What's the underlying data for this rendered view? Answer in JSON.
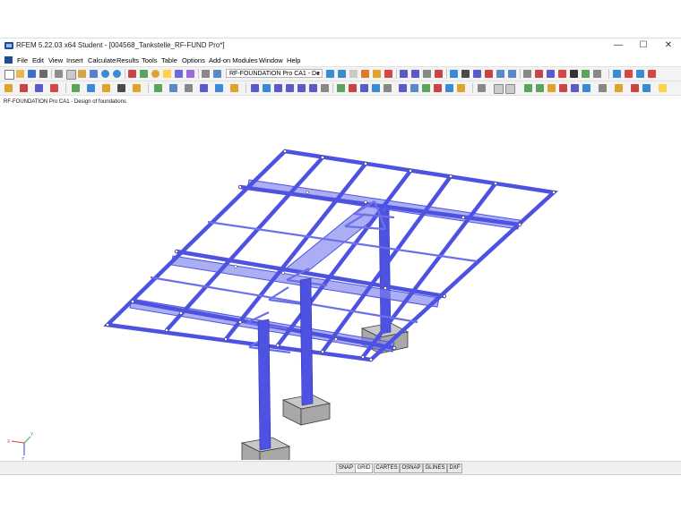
{
  "window": {
    "title": "RFEM 5.22.03 x64 Student - [004568_Tankstelle_RF-FUND Pro*]"
  },
  "window_controls": {
    "minimize": "—",
    "maximize": "☐",
    "close": "✕"
  },
  "menu": [
    "File",
    "Edit",
    "View",
    "Insert",
    "Calculate",
    "Results",
    "Tools",
    "Table",
    "Options",
    "Add-on Modules",
    "Window",
    "Help"
  ],
  "toolbar": {
    "module_combo": "RF-FOUNDATION Pro CA1 - De"
  },
  "viewport": {
    "panel_title": "RF-FOUNDATION Pro CA1 - Design of foundations"
  },
  "axes": {
    "x": "X",
    "y": "Y",
    "z": "Z"
  },
  "statusbar": {
    "buttons": [
      "SNAP",
      "GRID",
      "CARTES",
      "OSNAP",
      "GLINES",
      "DXF"
    ]
  },
  "colors": {
    "member": "#4e52e0",
    "member_light": "#7a7ff0",
    "foundation": "#a8a8a8",
    "window_bg": "#ffffff",
    "toolbar_bg": "#f3f3f3"
  }
}
